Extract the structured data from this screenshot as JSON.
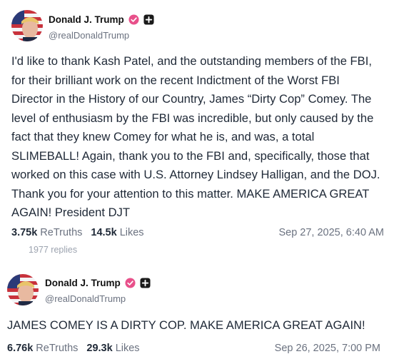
{
  "posts": [
    {
      "display_name": "Donald J. Trump",
      "handle": "@realDonaldTrump",
      "text": "I'd like to thank Kash Patel, and the outstanding members of the FBI, for their brilliant work on the recent Indictment of the Worst FBI Director in the History of our Country, James “Dirty Cop” Comey. The level of enthusiasm by the FBI was incredible, but only caused by the fact that they knew Comey for what he is, and was, a total SLIMEBALL! Again, thank you to the FBI and, specifically, those that worked on this case with U.S. Attorney Lindsey Halligan, and the DOJ. Thank you for your attention to this matter. MAKE AMERICA GREAT AGAIN! President DJT",
      "retruths_count": "3.75k",
      "retruths_label": "ReTruths",
      "likes_count": "14.5k",
      "likes_label": "Likes",
      "timestamp": "Sep 27, 2025, 6:40 AM",
      "replies": "1977 replies"
    },
    {
      "display_name": "Donald J. Trump",
      "handle": "@realDonaldTrump",
      "text": "JAMES COMEY IS A DIRTY COP. MAKE AMERICA GREAT AGAIN!",
      "retruths_count": "6.76k",
      "retruths_label": "ReTruths",
      "likes_count": "29.3k",
      "likes_label": "Likes",
      "timestamp": "Sep 26, 2025, 7:00 PM"
    }
  ],
  "icons": {
    "verified": "verified-badge-icon",
    "plus": "plus-badge-icon"
  },
  "colors": {
    "verified_badge": "#e8508a",
    "plus_badge": "#1a1a1a",
    "muted_text": "#6b7280",
    "body_text": "#1f2937"
  }
}
